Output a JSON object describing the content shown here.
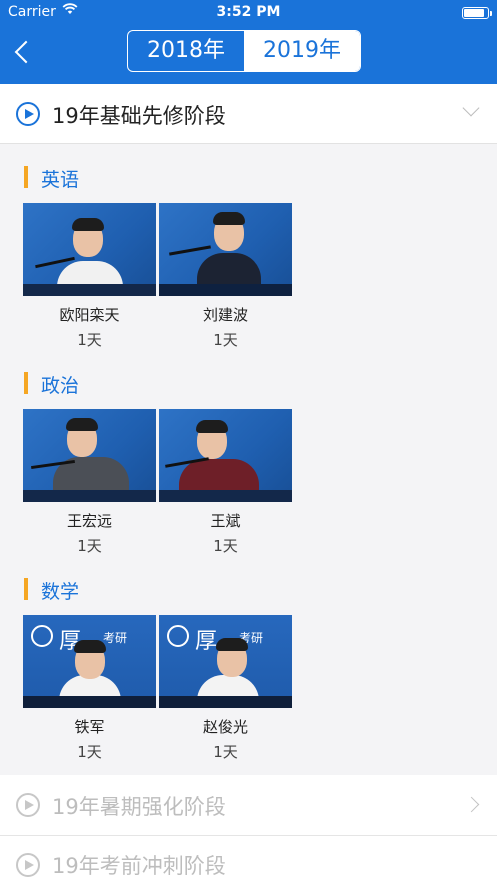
{
  "status_bar": {
    "carrier": "Carrier",
    "time": "3:52 PM",
    "battery_level": 0.9
  },
  "nav": {
    "back_icon": "chevron-left-icon",
    "years": [
      "2018年",
      "2019年"
    ],
    "selected_year": "2019年"
  },
  "stages": [
    {
      "title": "19年基础先修阶段",
      "expanded": true
    },
    {
      "title": "19年暑期强化阶段",
      "expanded": false
    },
    {
      "title": "19年考前冲刺阶段",
      "expanded": false
    }
  ],
  "subjects": [
    {
      "name": "英语",
      "teachers": [
        {
          "name": "欧阳栾天",
          "days": "1天"
        },
        {
          "name": "刘建波",
          "days": "1天"
        }
      ]
    },
    {
      "name": "政治",
      "teachers": [
        {
          "name": "王宏远",
          "days": "1天"
        },
        {
          "name": "王斌",
          "days": "1天"
        }
      ]
    },
    {
      "name": "数学",
      "teachers": [
        {
          "name": "铁军",
          "days": "1天"
        },
        {
          "name": "赵俊光",
          "days": "1天"
        }
      ]
    }
  ],
  "thumbnail_logo": {
    "brand": "厚",
    "sub": "考研"
  },
  "colors": {
    "primary": "#1a73d9",
    "accent_bar": "#f5a623"
  }
}
